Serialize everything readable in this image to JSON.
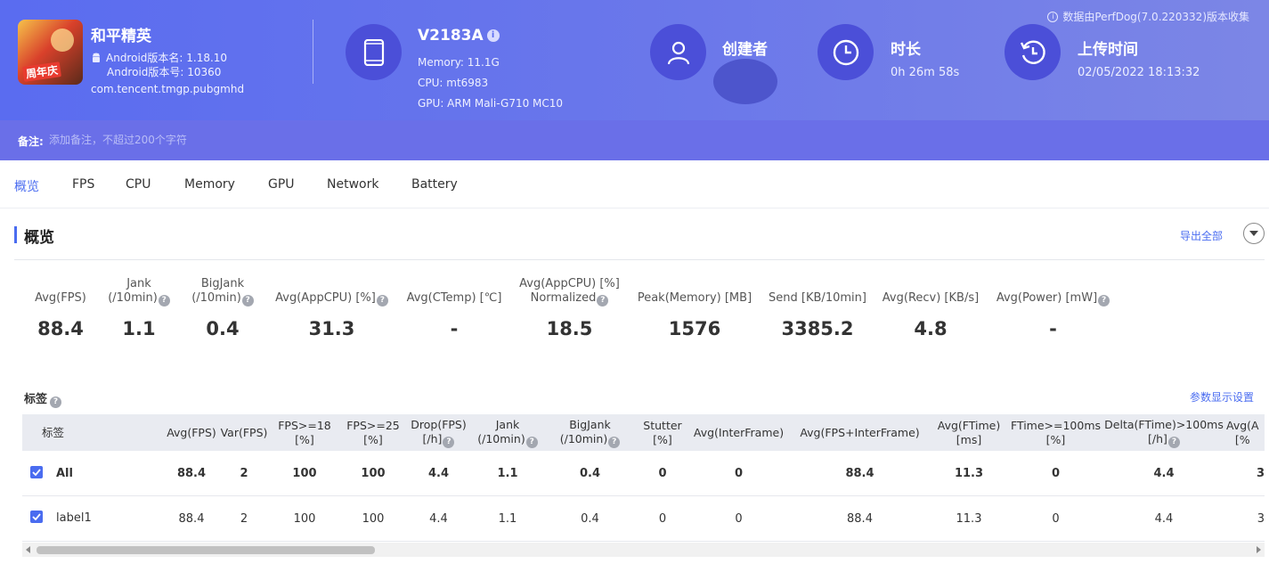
{
  "header": {
    "source_note": "数据由PerfDog(7.0.220332)版本收集",
    "app": {
      "name": "和平精英",
      "version_name": "Android版本名: 1.18.10",
      "version_code": "Android版本号: 10360",
      "package": "com.tencent.tmgp.pubgmhd",
      "logo_text": "周年庆"
    },
    "device": {
      "model": "V2183A",
      "memory": "Memory: 11.1G",
      "cpu": "CPU: mt6983",
      "gpu": "GPU: ARM Mali-G710 MC10"
    },
    "creator": {
      "title": "创建者",
      "value": ""
    },
    "duration": {
      "title": "时长",
      "value": "0h 26m 58s"
    },
    "upload": {
      "title": "上传时间",
      "value": "02/05/2022 18:13:32"
    },
    "note": {
      "label": "备注:",
      "placeholder": "添加备注，不超过200个字符"
    }
  },
  "tabs": [
    {
      "label": "概览",
      "active": true
    },
    {
      "label": "FPS"
    },
    {
      "label": "CPU"
    },
    {
      "label": "Memory"
    },
    {
      "label": "GPU"
    },
    {
      "label": "Network"
    },
    {
      "label": "Battery"
    }
  ],
  "overview": {
    "title": "概览",
    "export_label": "导出全部",
    "stats": [
      {
        "label": "Avg(FPS)",
        "value": "88.4"
      },
      {
        "label": "Jank",
        "label2": "(/10min)",
        "value": "1.1"
      },
      {
        "label": "BigJank",
        "label2": "(/10min)",
        "value": "0.4"
      },
      {
        "label": "Avg(AppCPU) [%]",
        "value": "31.3"
      },
      {
        "label": "Avg(CTemp) [℃]",
        "value": "-"
      },
      {
        "label": "Avg(AppCPU) [%]",
        "label2": "Normalized",
        "value": "18.5"
      },
      {
        "label": "Peak(Memory) [MB]",
        "value": "1576"
      },
      {
        "label": "Send [KB/10min]",
        "value": "3385.2"
      },
      {
        "label": "Avg(Recv) [KB/s]",
        "value": "4.8"
      },
      {
        "label": "Avg(Power) [mW]",
        "value": "-"
      }
    ]
  },
  "tags": {
    "title": "标签",
    "param_settings": "参数显示设置",
    "columns": [
      {
        "l1": "标签"
      },
      {
        "l1": "Avg(FPS)"
      },
      {
        "l1": "Var(FPS)"
      },
      {
        "l1": "FPS>=18",
        "l2": "[%]"
      },
      {
        "l1": "FPS>=25",
        "l2": "[%]"
      },
      {
        "l1": "Drop(FPS)",
        "l2": "[/h]"
      },
      {
        "l1": "Jank",
        "l2": "(/10min)"
      },
      {
        "l1": "BigJank",
        "l2": "(/10min)"
      },
      {
        "l1": "Stutter",
        "l2": "[%]"
      },
      {
        "l1": "Avg(InterFrame)"
      },
      {
        "l1": "Avg(FPS+InterFrame)"
      },
      {
        "l1": "Avg(FTime)",
        "l2": "[ms]"
      },
      {
        "l1": "FTime>=100ms",
        "l2": "[%]"
      },
      {
        "l1": "Delta(FTime)>100ms",
        "l2": "[/h]"
      },
      {
        "l1": "Avg(A",
        "l2": "[%"
      }
    ],
    "rows": [
      {
        "label": "All",
        "cells": [
          "88.4",
          "2",
          "100",
          "100",
          "4.4",
          "1.1",
          "0.4",
          "0",
          "0",
          "88.4",
          "11.3",
          "0",
          "4.4",
          "3"
        ]
      },
      {
        "label": "label1",
        "cells": [
          "88.4",
          "2",
          "100",
          "100",
          "4.4",
          "1.1",
          "0.4",
          "0",
          "0",
          "88.4",
          "11.3",
          "0",
          "4.4",
          "3"
        ]
      }
    ]
  }
}
